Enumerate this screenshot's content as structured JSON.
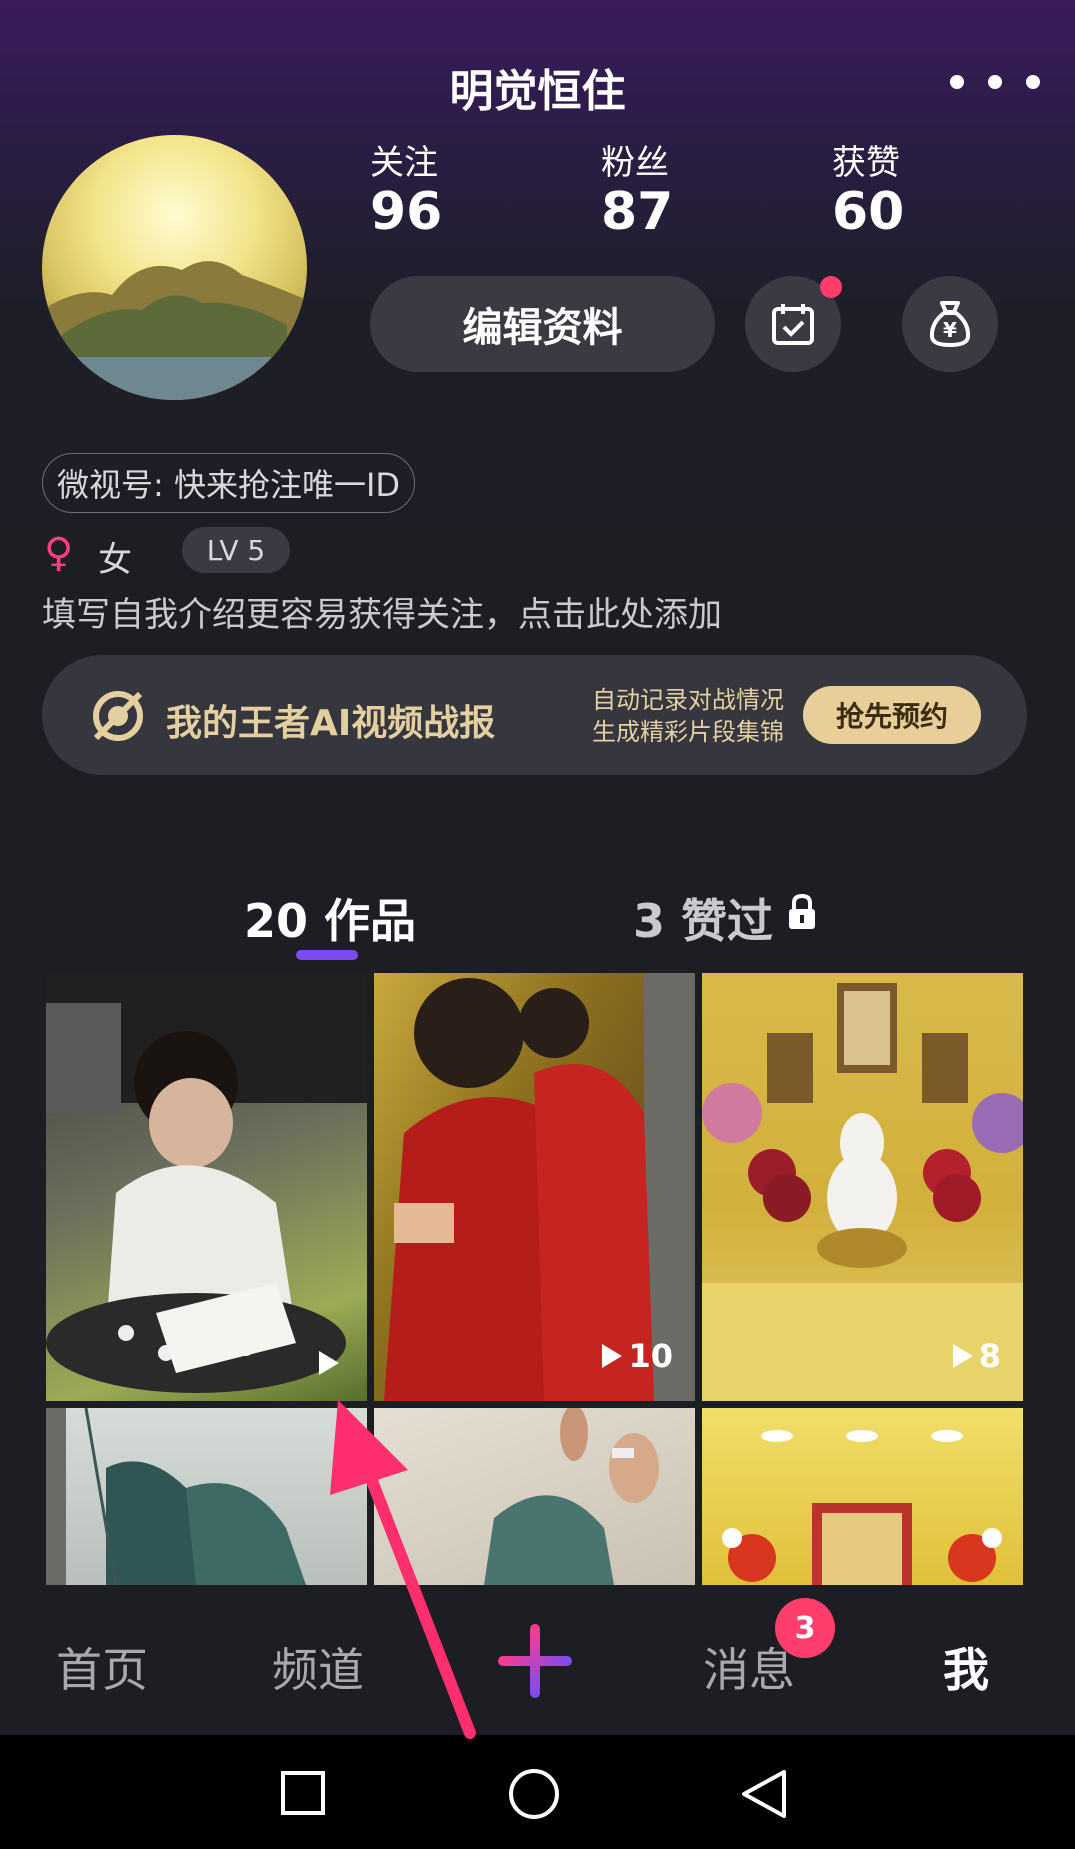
{
  "header": {
    "username": "明觉恒住"
  },
  "stats": [
    {
      "label": "关注",
      "value": "96"
    },
    {
      "label": "粉丝",
      "value": "87"
    },
    {
      "label": "获赞",
      "value": "60"
    }
  ],
  "actions": {
    "edit_profile_label": "编辑资料",
    "checkin_has_notification": true
  },
  "profile": {
    "weishi_id_text": "微视号: 快来抢注唯一ID",
    "gender_symbol": "♀",
    "gender_text": "女",
    "level": "LV 5",
    "bio_placeholder": "填写自我介绍更容易获得关注，点击此处添加"
  },
  "banner": {
    "title": "我的王者AI视频战报",
    "desc_line1": "自动记录对战情况",
    "desc_line2": "生成精彩片段集锦",
    "button_label": "抢先预约",
    "text_color": "#e3cfa0",
    "button_color": "#e8cf9a"
  },
  "tabs": {
    "works_label": "20 作品",
    "liked_label": "3 赞过",
    "accent_color": "#7b4cf5"
  },
  "videos": [
    {
      "count": "",
      "scene": "child-reading"
    },
    {
      "count": "10",
      "scene": "people-red-shirts"
    },
    {
      "count": "8",
      "scene": "altar-guanyin"
    },
    {
      "count": "",
      "scene": "nets"
    },
    {
      "count": "",
      "scene": "hands-net"
    },
    {
      "count": "",
      "scene": "shrine-flowers"
    }
  ],
  "bottom_nav": {
    "home": "首页",
    "channel": "频道",
    "messages": "消息",
    "messages_badge": "3",
    "me": "我"
  }
}
